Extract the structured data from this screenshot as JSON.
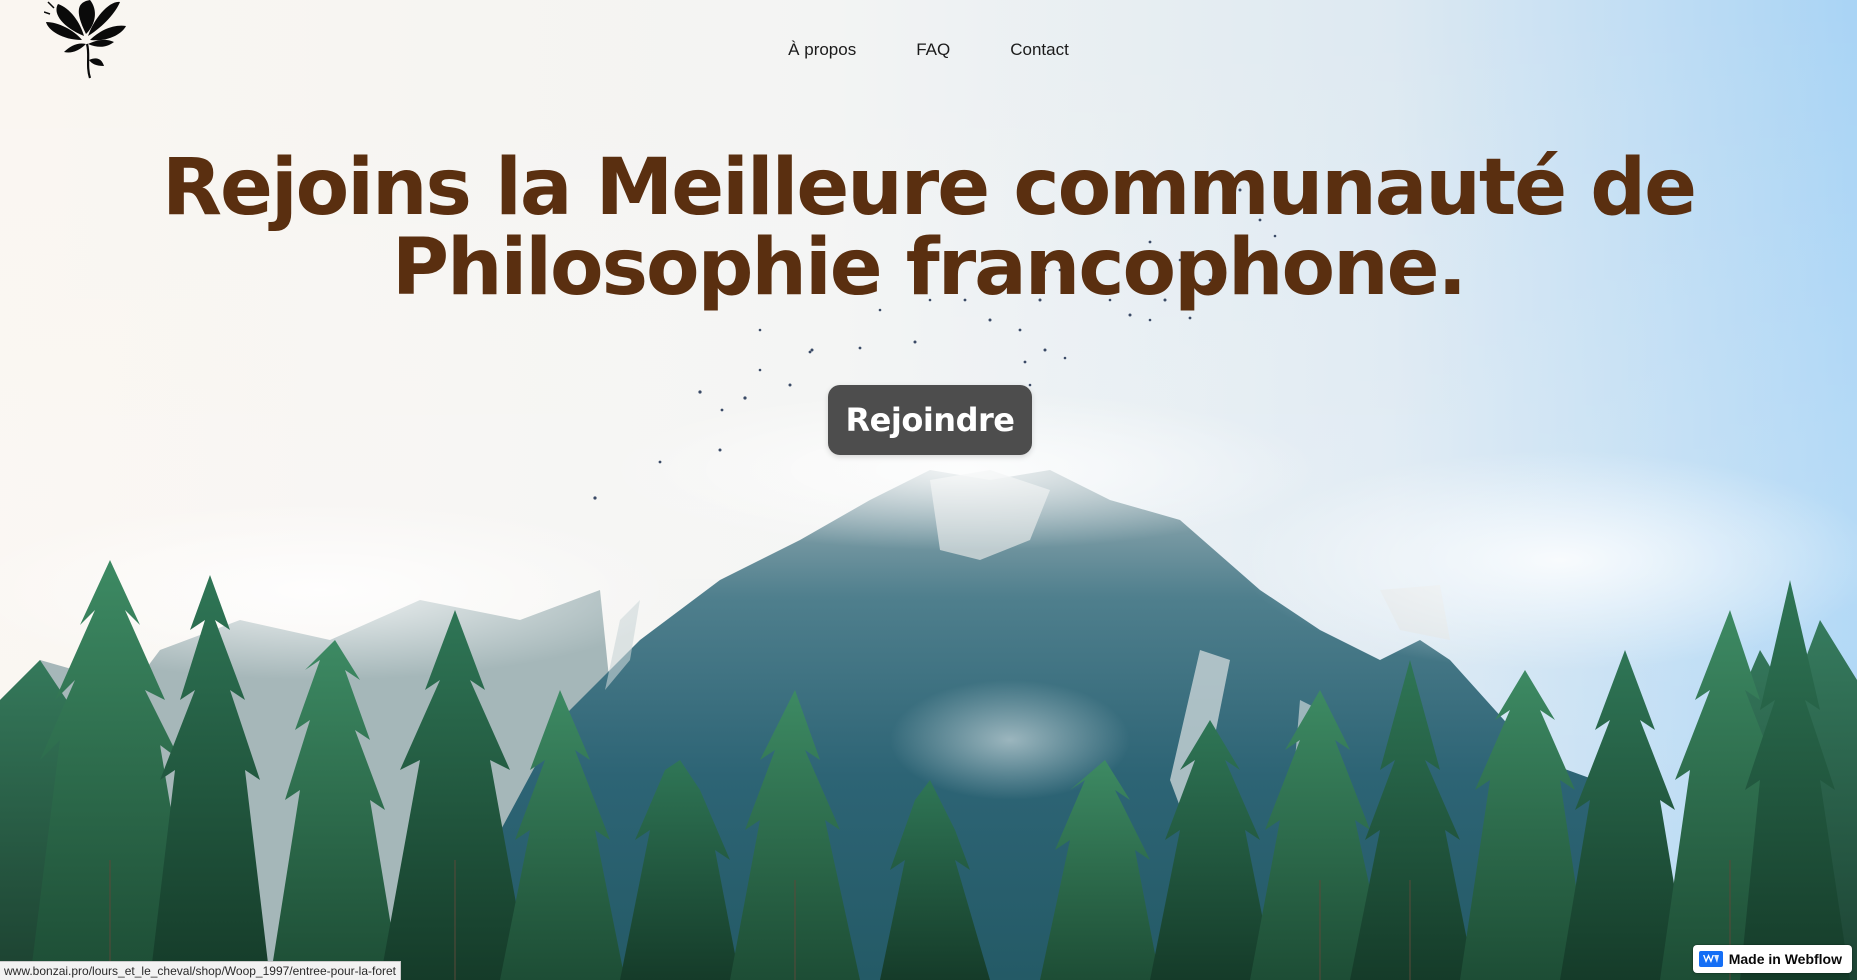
{
  "nav": {
    "items": [
      {
        "label": "À propos"
      },
      {
        "label": "FAQ"
      },
      {
        "label": "Contact"
      }
    ]
  },
  "hero": {
    "title_line1": "Rejoins la Meilleure communauté de",
    "title_line2": "Philosophie francophone.",
    "cta_label": "Rejoindre"
  },
  "status_bar": {
    "url": "www.bonzai.pro/lours_et_le_cheval/shop/Woop_1997/entree-pour-la-foret"
  },
  "badge": {
    "label": "Made in Webflow"
  },
  "colors": {
    "title": "#5a2f10",
    "button_bg": "#4d4d4d",
    "button_text": "#ffffff",
    "webflow_blue": "#146ef5",
    "sky": "#a9d4f5",
    "forest": "#1f5a3f"
  },
  "icons": {
    "logo": "lotus-flower-icon",
    "webflow": "webflow-logo-icon"
  }
}
